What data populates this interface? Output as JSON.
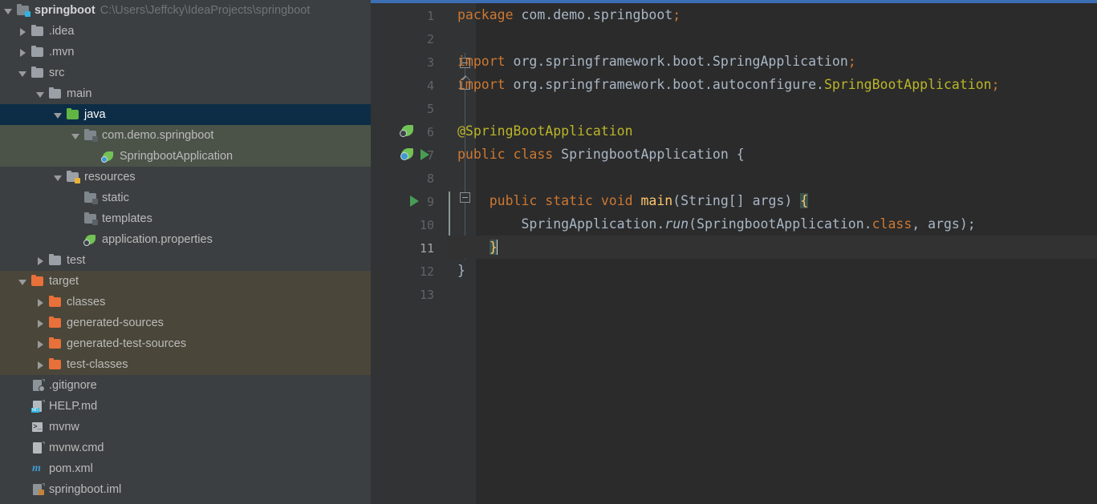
{
  "project": {
    "root_label": "springboot",
    "root_path": "C:\\Users\\Jeffcky\\IdeaProjects\\springboot",
    "items": [
      {
        "label": ".idea",
        "icon": "folder-icon",
        "indent": 1,
        "arrow": "right",
        "state": "normal"
      },
      {
        "label": ".mvn",
        "icon": "folder-icon",
        "indent": 1,
        "arrow": "right",
        "state": "normal"
      },
      {
        "label": "src",
        "icon": "folder-icon",
        "indent": 1,
        "arrow": "down",
        "state": "normal"
      },
      {
        "label": "main",
        "icon": "folder-icon",
        "indent": 2,
        "arrow": "down",
        "state": "normal"
      },
      {
        "label": "java",
        "icon": "source-folder-icon",
        "indent": 3,
        "arrow": "down",
        "state": "selected"
      },
      {
        "label": "com.demo.springboot",
        "icon": "package-icon",
        "indent": 4,
        "arrow": "down",
        "state": "source-package"
      },
      {
        "label": "SpringbootApplication",
        "icon": "spring-class-icon",
        "indent": 5,
        "arrow": "none",
        "state": "source-package"
      },
      {
        "label": "resources",
        "icon": "resources-folder-icon",
        "indent": 3,
        "arrow": "down",
        "state": "normal"
      },
      {
        "label": "static",
        "icon": "package-icon",
        "indent": 4,
        "arrow": "none",
        "state": "normal"
      },
      {
        "label": "templates",
        "icon": "package-icon",
        "indent": 4,
        "arrow": "none",
        "state": "normal"
      },
      {
        "label": "application.properties",
        "icon": "spring-properties-icon",
        "indent": 4,
        "arrow": "none",
        "state": "normal"
      },
      {
        "label": "test",
        "icon": "folder-icon",
        "indent": 2,
        "arrow": "right",
        "state": "normal"
      },
      {
        "label": "target",
        "icon": "excluded-folder-icon",
        "indent": 1,
        "arrow": "down",
        "state": "excluded"
      },
      {
        "label": "classes",
        "icon": "excluded-folder-icon",
        "indent": 2,
        "arrow": "right",
        "state": "excluded"
      },
      {
        "label": "generated-sources",
        "icon": "excluded-folder-icon",
        "indent": 2,
        "arrow": "right",
        "state": "excluded"
      },
      {
        "label": "generated-test-sources",
        "icon": "excluded-folder-icon",
        "indent": 2,
        "arrow": "right",
        "state": "excluded"
      },
      {
        "label": "test-classes",
        "icon": "excluded-folder-icon",
        "indent": 2,
        "arrow": "right",
        "state": "excluded"
      },
      {
        "label": ".gitignore",
        "icon": "gitignore-file-icon",
        "indent": 1,
        "arrow": "none",
        "state": "normal"
      },
      {
        "label": "HELP.md",
        "icon": "markdown-file-icon",
        "indent": 1,
        "arrow": "none",
        "state": "normal"
      },
      {
        "label": "mvnw",
        "icon": "shell-script-icon",
        "indent": 1,
        "arrow": "none",
        "state": "normal"
      },
      {
        "label": "mvnw.cmd",
        "icon": "text-file-icon",
        "indent": 1,
        "arrow": "none",
        "state": "normal"
      },
      {
        "label": "pom.xml",
        "icon": "maven-file-icon",
        "indent": 1,
        "arrow": "none",
        "state": "normal"
      },
      {
        "label": "springboot.iml",
        "icon": "module-file-icon",
        "indent": 1,
        "arrow": "none",
        "state": "normal"
      }
    ]
  },
  "editor": {
    "line_numbers": [
      "1",
      "2",
      "3",
      "4",
      "5",
      "6",
      "7",
      "8",
      "9",
      "10",
      "11",
      "12",
      "13"
    ],
    "active_line": 11,
    "lines": [
      {
        "n": "1",
        "tokens": [
          {
            "t": "package ",
            "c": "kw"
          },
          {
            "t": "com.demo.springboot",
            "c": "plain"
          },
          {
            "t": ";",
            "c": "kw"
          }
        ]
      },
      {
        "n": "2",
        "tokens": []
      },
      {
        "n": "3",
        "tokens": [
          {
            "t": "import ",
            "c": "kw"
          },
          {
            "t": "org.springframework.boot.SpringApplication",
            "c": "plain"
          },
          {
            "t": ";",
            "c": "kw"
          }
        ]
      },
      {
        "n": "4",
        "tokens": [
          {
            "t": "import ",
            "c": "kw"
          },
          {
            "t": "org.springframework.boot.autoconfigure.",
            "c": "plain"
          },
          {
            "t": "SpringBootApplication",
            "c": "ann"
          },
          {
            "t": ";",
            "c": "kw"
          }
        ]
      },
      {
        "n": "5",
        "tokens": []
      },
      {
        "n": "6",
        "tokens": [
          {
            "t": "@SpringBootApplication",
            "c": "ann"
          }
        ]
      },
      {
        "n": "7",
        "tokens": [
          {
            "t": "public class ",
            "c": "kw"
          },
          {
            "t": "SpringbootApplication",
            "c": "plain"
          },
          {
            "t": " {",
            "c": "plain"
          }
        ]
      },
      {
        "n": "8",
        "tokens": []
      },
      {
        "n": "9",
        "tokens": [
          {
            "t": "    ",
            "c": "plain"
          },
          {
            "t": "public static void ",
            "c": "kw"
          },
          {
            "t": "main",
            "c": "meth"
          },
          {
            "t": "(String[] args) ",
            "c": "plain"
          },
          {
            "t": "{",
            "c": "brace-hl"
          }
        ]
      },
      {
        "n": "10",
        "tokens": [
          {
            "t": "        SpringApplication.",
            "c": "plain"
          },
          {
            "t": "run",
            "c": "ital"
          },
          {
            "t": "(SpringbootApplication.",
            "c": "plain"
          },
          {
            "t": "class",
            "c": "kw"
          },
          {
            "t": ", args);",
            "c": "plain"
          }
        ]
      },
      {
        "n": "11",
        "tokens": [
          {
            "t": "    ",
            "c": "plain"
          },
          {
            "t": "}",
            "c": "brace-hl"
          }
        ]
      },
      {
        "n": "12",
        "tokens": [
          {
            "t": "}",
            "c": "plain"
          }
        ]
      },
      {
        "n": "13",
        "tokens": []
      }
    ],
    "gutter_markers": [
      {
        "line": 6,
        "icon": "spring-config-icon"
      },
      {
        "line": 7,
        "icon": "spring-bean-icon"
      },
      {
        "line": 7,
        "icon": "run-application-icon"
      },
      {
        "line": 9,
        "icon": "run-method-icon"
      }
    ],
    "colors": {
      "background": "#2b2b2b",
      "gutter_background": "#313335",
      "keyword": "#cc7832",
      "annotation": "#bbb529",
      "method": "#ffc66d",
      "text": "#a9b7c6",
      "line_number": "#606366",
      "current_line": "#323232",
      "top_accent": "#3c6eb4"
    }
  },
  "tree_colors": {
    "background": "#3c3f41",
    "selected": "#0d2d46",
    "source_package": "#4b5349",
    "excluded": "#4a4639",
    "text": "#bbbbbb",
    "path_text": "#6f7477"
  }
}
